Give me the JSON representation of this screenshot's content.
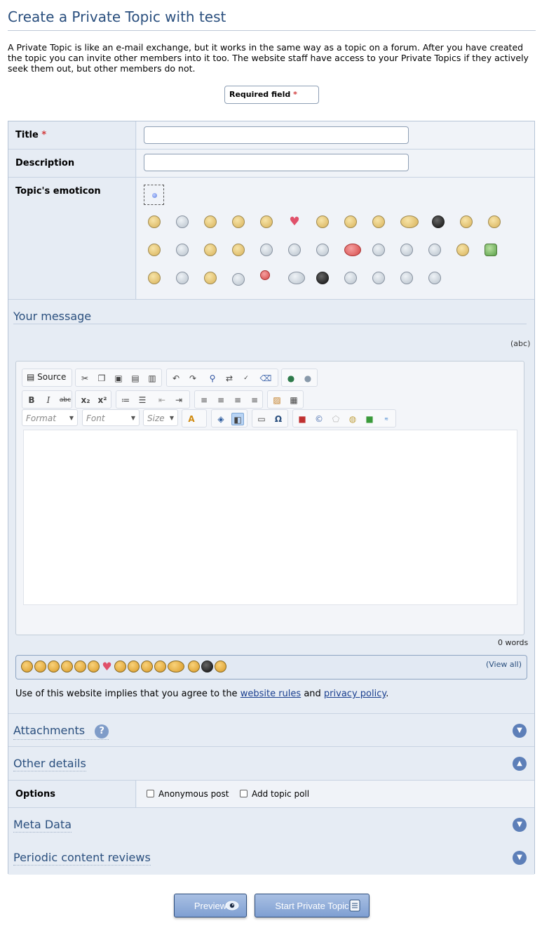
{
  "page": {
    "title": "Create a Private Topic with test",
    "intro": "A Private Topic is like an e-mail exchange, but it works in the same way as a topic on a forum. After you have created the topic you can invite other members into it too. The website staff have access to your Private Topics if they actively seek them out, but other members do not."
  },
  "required": {
    "label": "Required field",
    "star": "*"
  },
  "form": {
    "title_label": "Title",
    "title_star": "*",
    "title_value": "",
    "description_label": "Description",
    "description_value": "",
    "emoticon_label": "Topic's emoticon"
  },
  "message": {
    "title": "Your message",
    "spell_icon": "(abc)",
    "editor": {
      "source_label": "Source",
      "format_placeholder": "Format",
      "font_placeholder": "Font",
      "size_placeholder": "Size",
      "bold_label": "B",
      "italic_label": "I",
      "strike_label": "abc",
      "subscript_label": "x₂",
      "superscript_label": "x²"
    },
    "word_count": "0 words",
    "view_all": "(View all)"
  },
  "agreement": {
    "prefix": "Use of this website implies that you agree to the",
    "rules_link": "website rules",
    "middle": "and",
    "privacy_link": "privacy policy",
    "suffix": "."
  },
  "sections": {
    "attachments": "Attachments",
    "attachments_help": "?",
    "other_details": "Other details",
    "options_label": "Options",
    "anonymous_post": "Anonymous post",
    "add_topic_poll": "Add topic poll",
    "meta_data": "Meta Data",
    "periodic_reviews": "Periodic content reviews"
  },
  "buttons": {
    "preview": "Preview",
    "start": "Start Private Topic"
  },
  "colors": {
    "heading": "#2a4f7e",
    "panel": "#e6ecf4",
    "button": "#7f9fd2",
    "required_star": "#d23a3a"
  }
}
